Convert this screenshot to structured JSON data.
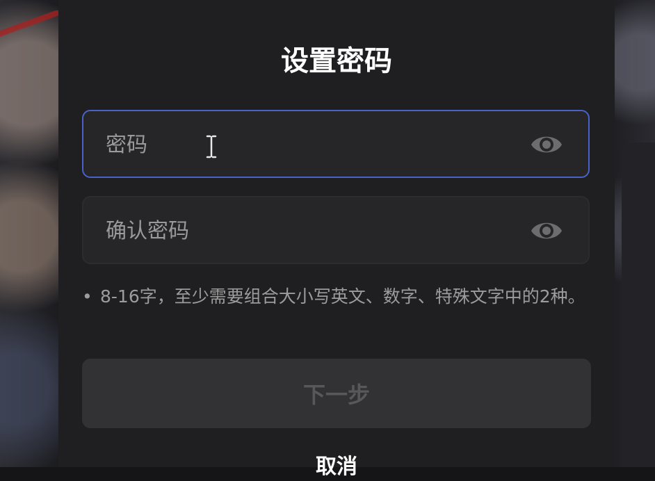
{
  "dialog": {
    "title": "设置密码",
    "password_field": {
      "placeholder": "密码",
      "value": ""
    },
    "confirm_field": {
      "placeholder": "确认密码",
      "value": ""
    },
    "hint_bullet": "•",
    "hint_text": "8-16字，至少需要组合大小写英文、数字、特殊文字中的2种。",
    "next_button": "下一步",
    "cancel_link": "取消"
  },
  "icons": {
    "password_visibility": "eye-icon",
    "confirm_visibility": "eye-icon",
    "mouse_cursor": "text-cursor-icon"
  },
  "colors": {
    "dialog_bg": "#1f1f21",
    "focus_border": "#4a62c8",
    "disabled_button_bg": "#323235",
    "disabled_button_text": "#58585b"
  }
}
